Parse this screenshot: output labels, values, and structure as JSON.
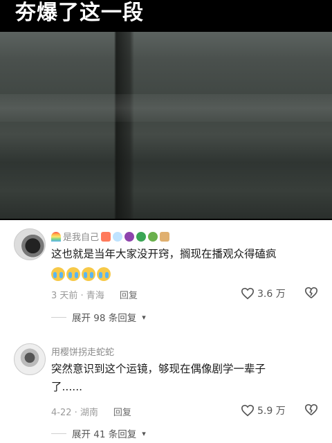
{
  "video": {
    "title": "夯爆了这一段"
  },
  "comments": [
    {
      "username": "是我自己",
      "text": "这也就是当年大家没开窍，搁现在播观众得磕疯",
      "time_location": "3 天前 · 青海",
      "reply_label": "回复",
      "likes": "3.6 万",
      "expand_label": "展开 98 条回复"
    },
    {
      "username": "用樱饼拐走蛇蛇",
      "text_line1": "突然意识到这个运镜，够现在偶像剧学一辈子",
      "text_line2": "了......",
      "time_location": "4-22 · 湖南",
      "reply_label": "回复",
      "likes": "5.9 万",
      "expand_label": "展开 41 条回复"
    }
  ],
  "colors": {
    "text_primary": "#1a1a1a",
    "text_secondary": "#9a9a9a",
    "background": "#ffffff"
  }
}
